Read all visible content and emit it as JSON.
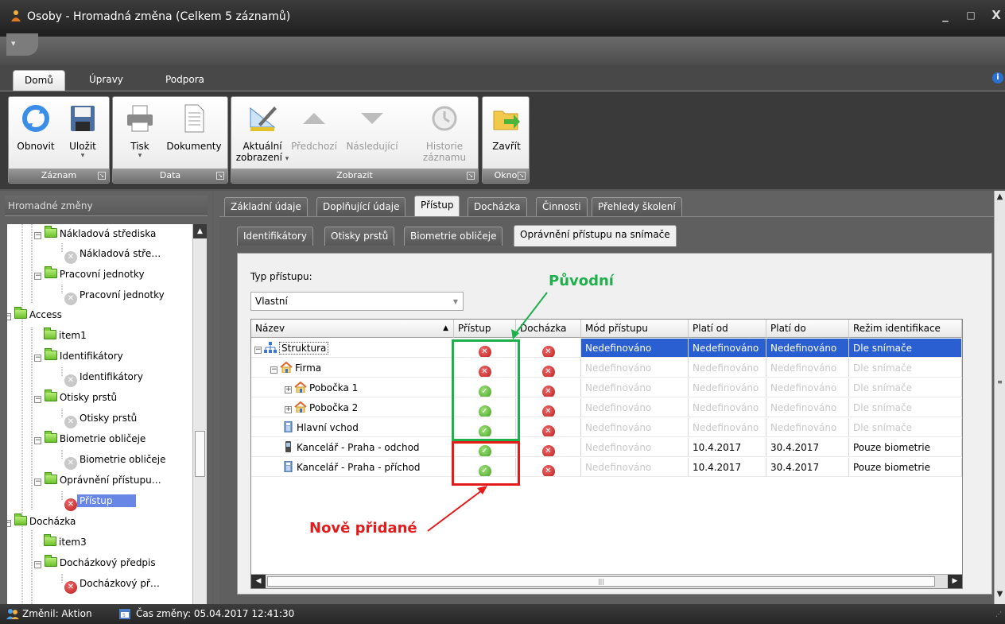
{
  "window": {
    "title": "Osoby - Hromadná změna (Celkem 5 záznamů)",
    "min": "_",
    "max": "□",
    "close": "X"
  },
  "qat": {
    "arrow": "▾"
  },
  "ribbon_tabs": [
    {
      "label": "Domů"
    },
    {
      "label": "Úpravy"
    },
    {
      "label": "Podpora"
    }
  ],
  "ribbon": {
    "groups": {
      "zaznam": "Záznam",
      "data": "Data",
      "zobrazit": "Zobrazit",
      "okno": "Okno"
    },
    "buttons": {
      "obnovit": "Obnovit",
      "ulozit": "Uložit",
      "tisk": "Tisk",
      "dokumenty": "Dokumenty",
      "aktualni1": "Aktuální",
      "aktualni2": "zobrazení",
      "predchozi": "Předchozí",
      "nasledujici": "Následující",
      "historie1": "Historie",
      "historie2": "záznamu",
      "zavrit": "Zavřít"
    }
  },
  "left": {
    "title": "Hromadné změny",
    "tree": [
      {
        "label": "Nákladová střediska",
        "icon": "folder"
      },
      {
        "label": "Nákladová stře…",
        "icon": "x-gray"
      },
      {
        "label": "Pracovní jednotky",
        "icon": "folder"
      },
      {
        "label": "Pracovní jednotky",
        "icon": "x-gray"
      },
      {
        "label": "Access",
        "icon": "folder"
      },
      {
        "label": "item1",
        "icon": "folder"
      },
      {
        "label": "Identifikátory",
        "icon": "folder"
      },
      {
        "label": "Identifikátory",
        "icon": "x-gray"
      },
      {
        "label": "Otisky prstů",
        "icon": "folder"
      },
      {
        "label": "Otisky prstů",
        "icon": "x-gray"
      },
      {
        "label": "Biometrie obličeje",
        "icon": "folder"
      },
      {
        "label": "Biometrie obličeje",
        "icon": "x-gray"
      },
      {
        "label": "Oprávnění přístupu…",
        "icon": "folder"
      },
      {
        "label": "Přístup",
        "icon": "x-red"
      },
      {
        "label": "Docházka",
        "icon": "folder"
      },
      {
        "label": "item3",
        "icon": "folder"
      },
      {
        "label": "Docházkový předpis",
        "icon": "folder"
      },
      {
        "label": "Docházkový př…",
        "icon": "x-red"
      }
    ]
  },
  "main_tabs": [
    {
      "label": "Základní údaje"
    },
    {
      "label": "Doplňující údaje"
    },
    {
      "label": "Přístup"
    },
    {
      "label": "Docházka"
    },
    {
      "label": "Činnosti"
    },
    {
      "label": "Přehledy školení"
    }
  ],
  "sub_tabs": [
    {
      "label": "Identifikátory"
    },
    {
      "label": "Otisky prstů"
    },
    {
      "label": "Biometrie obličeje"
    },
    {
      "label": "Oprávnění přístupu na snímače"
    }
  ],
  "typ_pristupu": {
    "label": "Typ přístupu:",
    "value": "Vlastní"
  },
  "grid": {
    "headers": [
      "Název",
      "Přístup",
      "Docházka",
      "Mód přístupu",
      "Platí od",
      "Platí do",
      "Režim identifikace"
    ],
    "sort_indicator": "▲",
    "rows": [
      {
        "name": "Struktura",
        "pristup": "x",
        "dochazka": "x",
        "mod": "Nedefinováno",
        "od": "Nedefinováno",
        "do": "Nedefinováno",
        "rezim": "Dle snímače"
      },
      {
        "name": "Firma",
        "pristup": "x",
        "dochazka": "x",
        "mod": "Nedefinováno",
        "od": "Nedefinováno",
        "do": "Nedefinováno",
        "rezim": "Dle snímače"
      },
      {
        "name": "Pobočka 1",
        "pristup": "check",
        "dochazka": "x",
        "mod": "Nedefinováno",
        "od": "Nedefinováno",
        "do": "Nedefinováno",
        "rezim": "Dle snímače"
      },
      {
        "name": "Pobočka 2",
        "pristup": "check",
        "dochazka": "x",
        "mod": "Nedefinováno",
        "od": "Nedefinováno",
        "do": "Nedefinováno",
        "rezim": "Dle snímače"
      },
      {
        "name": "Hlavní vchod",
        "pristup": "check",
        "dochazka": "x",
        "mod": "Nedefinováno",
        "od": "Nedefinováno",
        "do": "Nedefinováno",
        "rezim": "Dle snímače"
      },
      {
        "name": "Kancelář - Praha - odchod",
        "pristup": "check",
        "dochazka": "x",
        "mod": "Nedefinováno",
        "od": "10.4.2017",
        "do": "30.4.2017",
        "rezim": "Pouze biometrie"
      },
      {
        "name": "Kancelář - Praha - příchod",
        "pristup": "check",
        "dochazka": "x",
        "mod": "Nedefinováno",
        "od": "10.4.2017",
        "do": "30.4.2017",
        "rezim": "Pouze biometrie"
      }
    ],
    "hscroll_grip": "|||"
  },
  "annotations": {
    "original": "Původní",
    "new": "Nově přidané"
  },
  "status": {
    "changed_by": "Změnil: Aktion",
    "changed_time": "Čas změny: 05.04.2017 12:41:30"
  },
  "colors": {
    "selection": "#2a5fd2",
    "green_annotation": "#1faf4c",
    "red_annotation": "#e51b1b"
  }
}
